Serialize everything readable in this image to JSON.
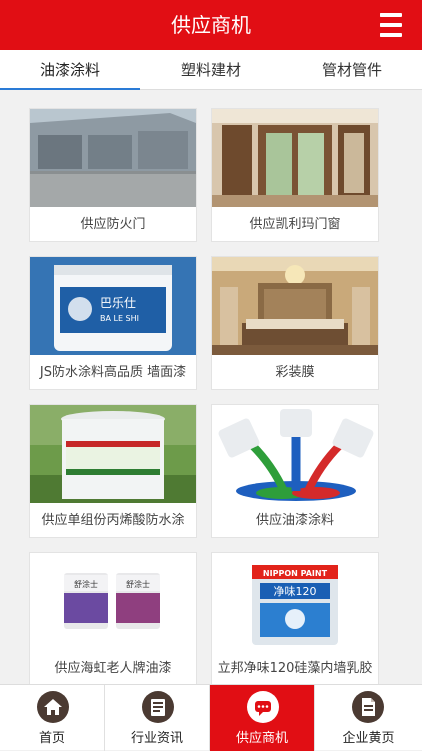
{
  "header": {
    "title": "供应商机",
    "menu_icon": "menu-icon"
  },
  "tabs": [
    {
      "label": "油漆涂料",
      "active": true
    },
    {
      "label": "塑料建材",
      "active": false
    },
    {
      "label": "管材管件",
      "active": false
    }
  ],
  "products": [
    {
      "caption": "供应防火门",
      "image": "factory-building-photo"
    },
    {
      "caption": "供应凯利玛门窗",
      "image": "interior-doors-photo"
    },
    {
      "caption": "JS防水涂料高品质 墙面漆",
      "image": "paint-bucket-blue-label-photo",
      "label_text": [
        "巴乐仕",
        "BA LE SHI"
      ]
    },
    {
      "caption": "彩装膜",
      "image": "bedroom-interior-photo"
    },
    {
      "caption": "供应单组份丙烯酸防水涂",
      "image": "white-bucket-grass-photo"
    },
    {
      "caption": "供应油漆涂料",
      "image": "paint-splash-cans-photo"
    },
    {
      "caption": "供应海虹老人牌油漆",
      "image": "two-paint-cans-photo",
      "label_text": [
        "舒涂士",
        "舒涂士"
      ]
    },
    {
      "caption": "立邦净味120硅藻内墙乳胶",
      "image": "nippon-paint-bucket-photo",
      "label_text": [
        "NIPPON PAINT",
        "净味120"
      ]
    }
  ],
  "bottom_nav": [
    {
      "label": "首页",
      "icon": "home-icon",
      "active": false
    },
    {
      "label": "行业资讯",
      "icon": "news-icon",
      "active": false
    },
    {
      "label": "供应商机",
      "icon": "chat-icon",
      "active": true
    },
    {
      "label": "企业黄页",
      "icon": "document-icon",
      "active": false
    }
  ],
  "colors": {
    "primary": "#e10e14",
    "tab_underline": "#2a7bd6",
    "icon_bg": "#4b3a32"
  }
}
